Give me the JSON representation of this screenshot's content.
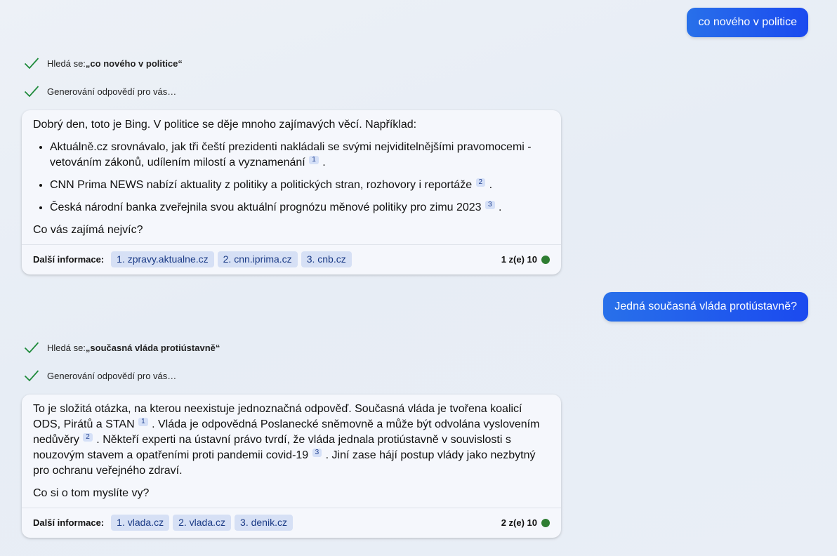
{
  "colors": {
    "user_bubble": "#2063ee",
    "check": "#1e8a3a",
    "source_chip": "#d6e0f5",
    "status_dot": "#2e7d32"
  },
  "conversation": [
    {
      "user_message": "co nového v politice",
      "search_prefix": "Hledá se: ",
      "search_query": "„co nového v politice“",
      "generating": "Generování odpovědí pro vás…",
      "answer": {
        "intro": "Dobrý den, toto je Bing. V politice se děje mnoho zajímavých věcí. Například:",
        "bullets": [
          {
            "text": "Aktuálně.cz srovnávalo, jak tři čeští prezidenti nakládali se svými nejviditelnějšími pravomocemi - vetováním zákonů, udílením milostí a vyznamenání",
            "ref": "1",
            "end": "."
          },
          {
            "text": "CNN Prima NEWS nabízí aktuality z politiky a politických stran, rozhovory i reportáže",
            "ref": "2",
            "end": "."
          },
          {
            "text": "Česká národní banka zveřejnila svou aktuální prognózu měnové politiky pro zimu 2023",
            "ref": "3",
            "end": "."
          }
        ],
        "closing": "Co vás zajímá nejvíc?"
      },
      "footer": {
        "label": "Další informace:",
        "sources": [
          "1. zpravy.aktualne.cz",
          "2. cnn.iprima.cz",
          "3. cnb.cz"
        ],
        "counter": "1 z(e) 10"
      }
    },
    {
      "user_message": "Jedná současná vláda protiústavně?",
      "search_prefix": "Hledá se: ",
      "search_query": "„současná vláda protiústavně“",
      "generating": "Generování odpovědí pro vás…",
      "answer": {
        "p1": "To je složitá otázka, na kterou neexistuje jednoznačná odpověď. Současná vláda je tvořena koalicí ODS, Pirátů a STAN",
        "ref1": "1",
        "p2": ". Vláda je odpovědná Poslanecké sněmovně a může být odvolána vyslovením nedůvěry",
        "ref2": "2",
        "p3": ". Někteří experti na ústavní právo tvrdí, že vláda jednala protiústavně v souvislosti s nouzovým stavem a opatřeními proti pandemii covid-19",
        "ref3": "3",
        "p4": ". Jiní zase hájí postup vlády jako nezbytný pro ochranu veřejného zdraví.",
        "closing": "Co si o tom myslíte vy?"
      },
      "footer": {
        "label": "Další informace:",
        "sources": [
          "1. vlada.cz",
          "2. vlada.cz",
          "3. denik.cz"
        ],
        "counter": "2 z(e) 10"
      }
    }
  ]
}
